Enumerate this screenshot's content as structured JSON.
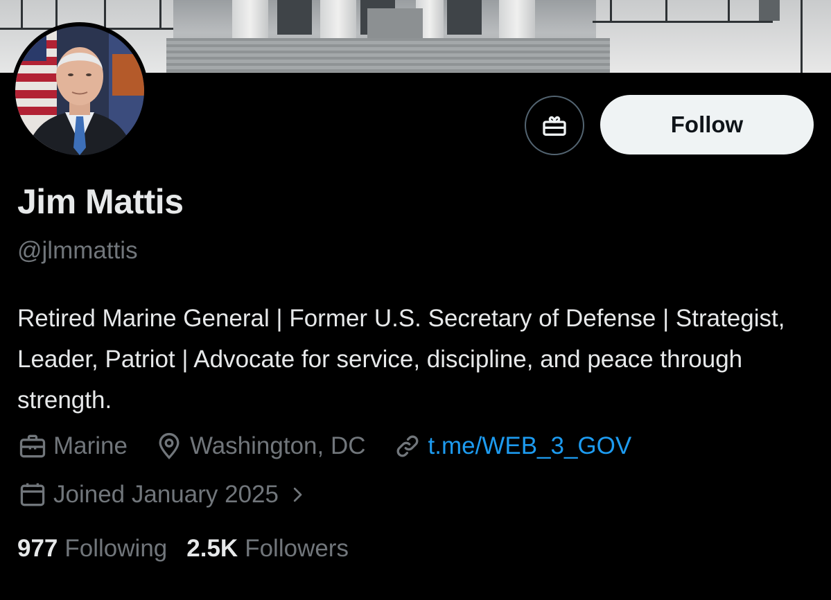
{
  "profile": {
    "name": "Jim Mattis",
    "handle": "@jlmmattis",
    "bio": "Retired Marine General | Former U.S. Secretary of Defense | Strategist, Leader, Patriot | Advocate for service, discipline, and peace through strength.",
    "profession": "Marine",
    "location": "Washington, DC",
    "website": "t.me/WEB_3_GOV",
    "joined": "Joined January 2025"
  },
  "actions": {
    "follow_label": "Follow",
    "gift_icon": "gift-icon"
  },
  "stats": {
    "following_count": "977",
    "following_label": "Following",
    "followers_count": "2.5K",
    "followers_label": "Followers"
  },
  "colors": {
    "background": "#000000",
    "primary_text": "#e7e9ea",
    "secondary_text": "#71767b",
    "link": "#1d9bf0",
    "follow_button_bg": "#eff3f4"
  }
}
